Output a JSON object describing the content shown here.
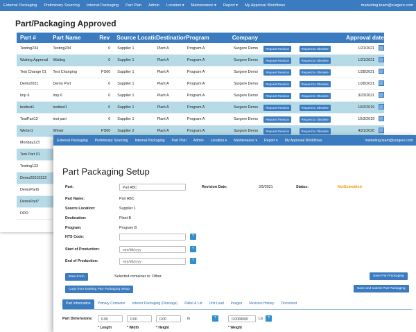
{
  "nav": {
    "items": [
      "External Packaging",
      "Preliminary Sourcing",
      "Internal Packaging",
      "Part Plan",
      "Admin",
      "Location ▾",
      "Maintenance ▾",
      "Report ▾",
      "My Approval Workflows"
    ],
    "email": "marketing.team@surgere.com"
  },
  "back": {
    "title": "Part/Packaging Approved",
    "headers": [
      "Part #",
      "Part Name",
      "Rev",
      "Source Location",
      "Destination",
      "Program",
      "Company",
      "",
      "",
      "Approval date"
    ],
    "request_revision": "Request Revision",
    "request_obsolete": "Request to Obsolete",
    "rows": [
      [
        "Testing234",
        "Testing234",
        "0",
        "Supplier 1",
        "Plant A",
        "Program A",
        "Surgere Demo",
        "1/21/2021"
      ],
      [
        "Waiting Approval",
        "Waiting",
        "0",
        "Supplier 1",
        "Plant A",
        "Program A",
        "Surgere Demo",
        "1/21/2021"
      ],
      [
        "Test Change 01",
        "Test Changing",
        "PS00",
        "Supplier 1",
        "Plant A",
        "Program A",
        "Surgere Demo",
        "1/28/2021"
      ],
      [
        "Demo2021",
        "Demo Part",
        "0",
        "Supplier 1",
        "Plant A",
        "Program A",
        "Surgere Demo",
        "1/28/2021"
      ],
      [
        "Imp 6",
        "Imp 6",
        "0",
        "Supplier 1",
        "Plant A",
        "Program A",
        "Surgere Demo",
        "3/23/2021"
      ],
      [
        "testtest1",
        "testtest1",
        "0",
        "Supplier 1",
        "Plant A",
        "Program A",
        "Surgere Demo",
        "10/2/2019"
      ],
      [
        "TestPart12",
        "test part",
        "0",
        "Supplier 1",
        "Plant A",
        "Program A",
        "Surgere Demo",
        "10/3/2019"
      ],
      [
        "Winter1",
        "Winter",
        "PS00",
        "Supplier 2",
        "Plant A",
        "Program A",
        "Surgere Demo",
        "4/21/2020"
      ],
      [
        "Monday123",
        "",
        "",
        "",
        "",
        "",
        "",
        ""
      ],
      [
        "Test Part 01",
        "",
        "",
        "",
        "",
        "",
        "",
        ""
      ],
      [
        "Testing123",
        "",
        "",
        "",
        "",
        "",
        "",
        ""
      ],
      [
        "Demo20210222",
        "",
        "",
        "",
        "",
        "",
        "",
        ""
      ],
      [
        "DemoPart5",
        "",
        "",
        "",
        "",
        "",
        "",
        ""
      ],
      [
        "DemoPart7",
        "",
        "",
        "",
        "",
        "",
        "",
        ""
      ],
      [
        "DDD",
        "",
        "",
        "",
        "",
        "",
        "",
        ""
      ]
    ]
  },
  "front": {
    "title": "Part Packaging Setup",
    "part_label": "Part:",
    "part_value": "Part ABC",
    "revision_label": "Revision Date:",
    "revision_value": "3/5/2021",
    "status_label": "Status:",
    "status_value": "NotSubmitted",
    "part_name_label": "Part Name:",
    "part_name_value": "Part ABC",
    "source_label": "Source Location:",
    "source_value": "Supplier 1",
    "destination_label": "Destination:",
    "destination_value": "Plant B",
    "program_label": "Program:",
    "program_value": "Program B",
    "hts_label": "HTS Code:",
    "hts_value": "",
    "start_label": "Start of Production:",
    "start_placeholder": "mm/dd/yyyy",
    "end_label": "End of Production:",
    "end_placeholder": "mm/dd/yyyy",
    "q_mark": "?",
    "data_form_btn": "Data Form",
    "selected_container": "Selected container is: Other",
    "copy_btn": "Copy from Existing Part Packaging Setup",
    "save_btn": "Save Part Packaging",
    "save_submit_btn": "Save and submit Part Packaging",
    "tabs": [
      "Part Information",
      "Primary Container",
      "Interior Packaging (Dunnage)",
      "Pallet & Lid",
      "Unit Load",
      "Images",
      "Revision History",
      "Document"
    ],
    "dims_label": "Part Dimensions:",
    "dims": [
      "0.00",
      "0.00",
      "0.00"
    ],
    "dims_unit": "in",
    "weight_value": "0.0000000",
    "weight_unit": "Lb",
    "length_label": "* Length",
    "width_label": "* Width",
    "height_label": "* Height",
    "weight_label": "* Weight"
  },
  "colors": {
    "nav": "#3b7bbf",
    "row_alt": "#b7dbe6",
    "status": "#e8a000"
  }
}
